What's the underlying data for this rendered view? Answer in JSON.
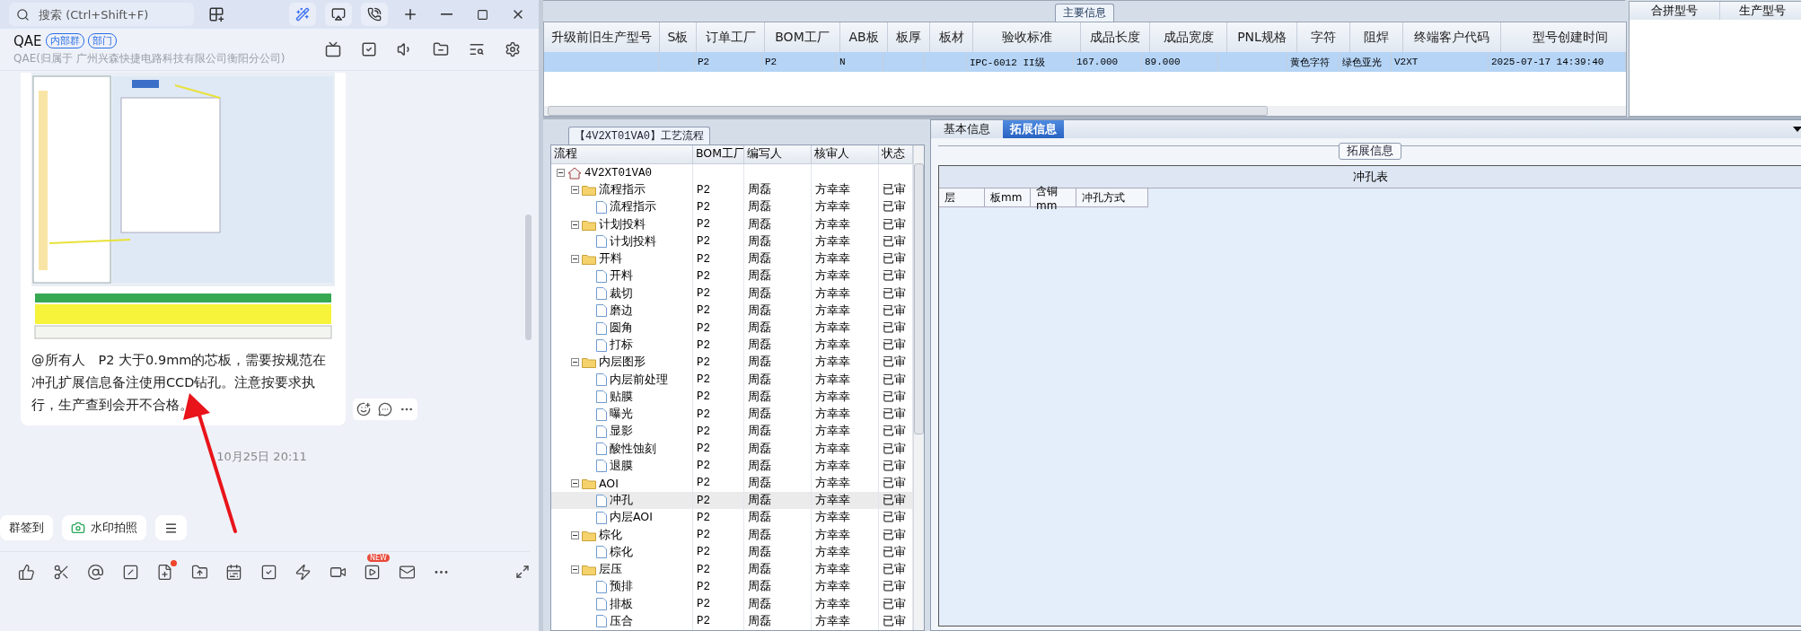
{
  "chat_window": {
    "search": {
      "placeholder": "搜索 (Ctrl+Shift+F)"
    },
    "group": {
      "name": "QAE",
      "tags": [
        "内部群",
        "部门"
      ],
      "subtitle": "QAE(归属于 广州兴森快捷电路科技有限公司衡阳分公司)"
    },
    "message": {
      "text": "@所有人　P2  大于0.9mm的芯板，需要按规范在冲孔扩展信息备注使用CCD钻孔。注意按要求执行，生产查到会开不合格。"
    },
    "timestamp": "10月25日 20:11",
    "quick_actions": [
      {
        "kind": "text",
        "label": "群签到"
      },
      {
        "kind": "camera",
        "label": "水印拍照"
      },
      {
        "kind": "menu"
      }
    ],
    "toolbar": {
      "unread_dot": true,
      "new_badge": "NEW"
    }
  },
  "main_info": {
    "title": "主要信息",
    "columns": [
      "升级前旧生产型号",
      "S板",
      "订单工厂",
      "BOM工厂",
      "AB板",
      "板厚",
      "板材",
      "验收标准",
      "成品长度",
      "成品宽度",
      "PNL规格",
      "字符",
      "阻焊",
      "终端客户代码",
      "型号创建时间"
    ],
    "rows": [
      {
        "selected": true,
        "cells": [
          "",
          "",
          "P2",
          "P2",
          "N",
          "",
          "",
          "IPC-6012 II级",
          "167.000",
          "89.000",
          "",
          "黄色字符",
          "绿色亚光",
          "V2XT",
          "2025-07-17 14:39:40"
        ]
      }
    ],
    "side_columns": [
      "合拼型号",
      "生产型号"
    ]
  },
  "process_flow": {
    "title": "【4V2XT01VA0】工艺流程",
    "columns": [
      "流程",
      "BOM工厂",
      "编写人",
      "核审人",
      "状态"
    ],
    "tree": {
      "kind": "root",
      "label": "4V2XT01VA0",
      "expanded": true,
      "selected": false,
      "children": [
        {
          "kind": "folder",
          "label": "流程指示",
          "bom": "P2",
          "writer": "周磊",
          "reviewer": "方幸幸",
          "status": "已审",
          "expanded": true,
          "selected": false,
          "children": [
            {
              "kind": "step",
              "label": "流程指示",
              "bom": "P2",
              "writer": "周磊",
              "reviewer": "方幸幸",
              "status": "已审",
              "selected": false
            }
          ]
        },
        {
          "kind": "folder",
          "label": "计划投料",
          "bom": "P2",
          "writer": "周磊",
          "reviewer": "方幸幸",
          "status": "已审",
          "expanded": true,
          "selected": false,
          "children": [
            {
              "kind": "step",
              "label": "计划投料",
              "bom": "P2",
              "writer": "周磊",
              "reviewer": "方幸幸",
              "status": "已审",
              "selected": false
            }
          ]
        },
        {
          "kind": "folder",
          "label": "开料",
          "bom": "P2",
          "writer": "周磊",
          "reviewer": "方幸幸",
          "status": "已审",
          "expanded": true,
          "selected": false,
          "children": [
            {
              "kind": "step",
              "label": "开料",
              "bom": "P2",
              "writer": "周磊",
              "reviewer": "方幸幸",
              "status": "已审",
              "selected": false
            },
            {
              "kind": "step",
              "label": "裁切",
              "bom": "P2",
              "writer": "周磊",
              "reviewer": "方幸幸",
              "status": "已审",
              "selected": false
            },
            {
              "kind": "step",
              "label": "磨边",
              "bom": "P2",
              "writer": "周磊",
              "reviewer": "方幸幸",
              "status": "已审",
              "selected": false
            },
            {
              "kind": "step",
              "label": "圆角",
              "bom": "P2",
              "writer": "周磊",
              "reviewer": "方幸幸",
              "status": "已审",
              "selected": false
            },
            {
              "kind": "step",
              "label": "打标",
              "bom": "P2",
              "writer": "周磊",
              "reviewer": "方幸幸",
              "status": "已审",
              "selected": false
            }
          ]
        },
        {
          "kind": "folder",
          "label": "内层图形",
          "bom": "P2",
          "writer": "周磊",
          "reviewer": "方幸幸",
          "status": "已审",
          "expanded": true,
          "selected": false,
          "children": [
            {
              "kind": "step",
              "label": "内层前处理",
              "bom": "P2",
              "writer": "周磊",
              "reviewer": "方幸幸",
              "status": "已审",
              "selected": false
            },
            {
              "kind": "step",
              "label": "贴膜",
              "bom": "P2",
              "writer": "周磊",
              "reviewer": "方幸幸",
              "status": "已审",
              "selected": false
            },
            {
              "kind": "step",
              "label": "曝光",
              "bom": "P2",
              "writer": "周磊",
              "reviewer": "方幸幸",
              "status": "已审",
              "selected": false
            },
            {
              "kind": "step",
              "label": "显影",
              "bom": "P2",
              "writer": "周磊",
              "reviewer": "方幸幸",
              "status": "已审",
              "selected": false
            },
            {
              "kind": "step",
              "label": "酸性蚀刻",
              "bom": "P2",
              "writer": "周磊",
              "reviewer": "方幸幸",
              "status": "已审",
              "selected": false
            },
            {
              "kind": "step",
              "label": "退膜",
              "bom": "P2",
              "writer": "周磊",
              "reviewer": "方幸幸",
              "status": "已审",
              "selected": false
            }
          ]
        },
        {
          "kind": "folder",
          "label": "AOI",
          "bom": "P2",
          "writer": "周磊",
          "reviewer": "方幸幸",
          "status": "已审",
          "expanded": true,
          "selected": false,
          "children": [
            {
              "kind": "step",
              "label": "冲孔",
              "bom": "P2",
              "writer": "周磊",
              "reviewer": "方幸幸",
              "status": "已审",
              "selected": true
            },
            {
              "kind": "step",
              "label": "内层AOI",
              "bom": "P2",
              "writer": "周磊",
              "reviewer": "方幸幸",
              "status": "已审",
              "selected": false
            }
          ]
        },
        {
          "kind": "folder",
          "label": "棕化",
          "bom": "P2",
          "writer": "周磊",
          "reviewer": "方幸幸",
          "status": "已审",
          "expanded": true,
          "selected": false,
          "children": [
            {
              "kind": "step",
              "label": "棕化",
              "bom": "P2",
              "writer": "周磊",
              "reviewer": "方幸幸",
              "status": "已审",
              "selected": false
            }
          ]
        },
        {
          "kind": "folder",
          "label": "层压",
          "bom": "P2",
          "writer": "周磊",
          "reviewer": "方幸幸",
          "status": "已审",
          "expanded": true,
          "selected": false,
          "children": [
            {
              "kind": "step",
              "label": "预排",
              "bom": "P2",
              "writer": "周磊",
              "reviewer": "方幸幸",
              "status": "已审",
              "selected": false
            },
            {
              "kind": "step",
              "label": "排板",
              "bom": "P2",
              "writer": "周磊",
              "reviewer": "方幸幸",
              "status": "已审",
              "selected": false
            },
            {
              "kind": "step",
              "label": "压合",
              "bom": "P2",
              "writer": "周磊",
              "reviewer": "方幸幸",
              "status": "已审",
              "selected": false
            }
          ]
        }
      ]
    }
  },
  "detail": {
    "tabs": [
      {
        "label": "基本信息",
        "selected": false
      },
      {
        "label": "拓展信息",
        "selected": true
      }
    ],
    "group_title": "拓展信息",
    "table": {
      "title": "冲孔表",
      "columns": [
        "层",
        "板mm",
        "含铜mm",
        "冲孔方式"
      ]
    }
  }
}
